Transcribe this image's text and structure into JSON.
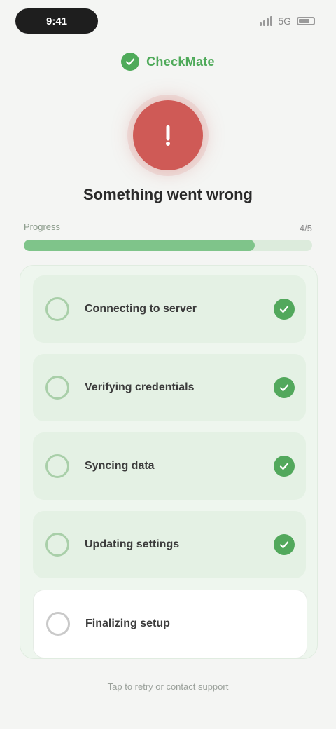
{
  "status": {
    "time": "9:41",
    "network": "5G"
  },
  "brand": {
    "name": "CheckMate"
  },
  "headline": "Something went wrong",
  "section": {
    "label": "Progress",
    "count": "4/5",
    "progress": 0.8
  },
  "steps": [
    {
      "label": "Connecting to server",
      "state": "done"
    },
    {
      "label": "Verifying credentials",
      "state": "done"
    },
    {
      "label": "Syncing data",
      "state": "done"
    },
    {
      "label": "Updating settings",
      "state": "done"
    },
    {
      "label": "Finalizing setup",
      "state": "pending"
    }
  ],
  "footer": "Tap to retry or contact support",
  "colors": {
    "accent": "#52a85c",
    "alert": "#cf5a56"
  }
}
